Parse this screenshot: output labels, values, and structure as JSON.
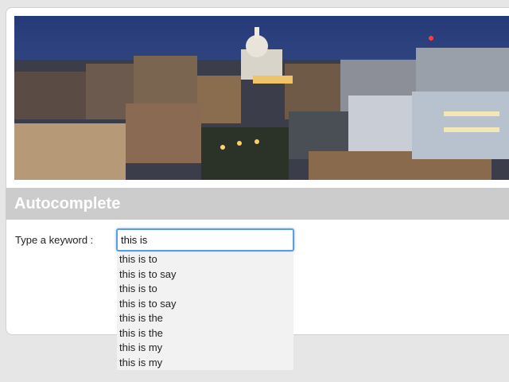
{
  "page": {
    "title": "Autocomplete"
  },
  "form": {
    "label": "Type a keyword :",
    "input_value": "this is"
  },
  "suggestions": [
    "this is to",
    "this is to say",
    "this is to",
    "this is to say",
    "this is the",
    "this is the",
    "this is my",
    "this is my"
  ],
  "colors": {
    "page_bg": "#e6e6e6",
    "title_bar": "#cccccc",
    "input_focus_border": "#5b9ddd",
    "menu_bg": "#f2f2f2"
  }
}
